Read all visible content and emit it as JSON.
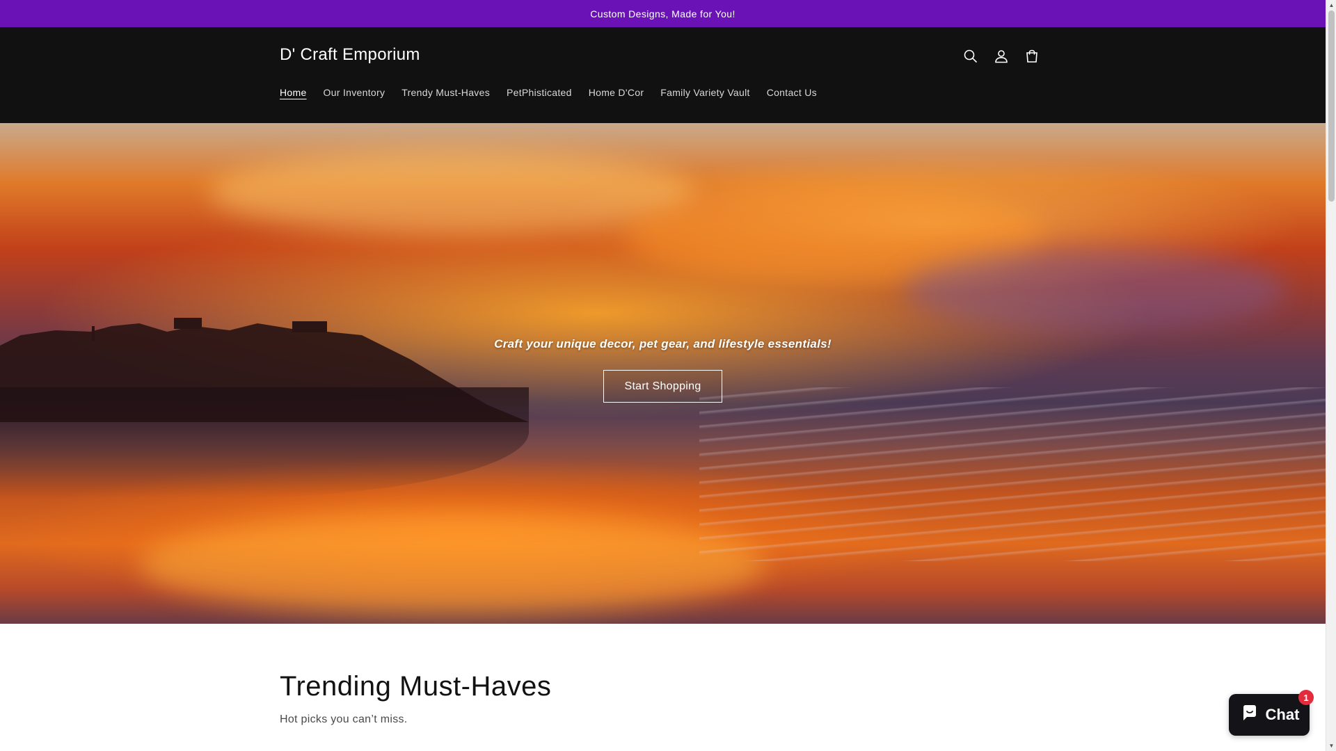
{
  "announcement": {
    "text": "Custom Designs, Made for You!"
  },
  "header": {
    "logo": "D' Craft Emporium",
    "icons": [
      "search-icon",
      "account-icon",
      "cart-icon"
    ],
    "nav": [
      {
        "label": "Home",
        "active": true
      },
      {
        "label": "Our Inventory",
        "active": false
      },
      {
        "label": "Trendy Must-Haves",
        "active": false
      },
      {
        "label": "PetPhisticated",
        "active": false
      },
      {
        "label": "Home D'Cor",
        "active": false
      },
      {
        "label": "Family Variety Vault",
        "active": false
      },
      {
        "label": "Contact Us",
        "active": false
      }
    ]
  },
  "hero": {
    "tagline": "Craft your unique decor, pet gear, and lifestyle essentials!",
    "cta": "Start Shopping"
  },
  "section": {
    "title": "Trending Must-Haves",
    "subtitle": "Hot picks you can’t miss."
  },
  "chat": {
    "label": "Chat",
    "badge": "1"
  },
  "colors": {
    "announcement_bg": "#6a12b6",
    "header_bg": "#111111",
    "chat_bg": "#131318",
    "badge_bg": "#e32c3c"
  }
}
